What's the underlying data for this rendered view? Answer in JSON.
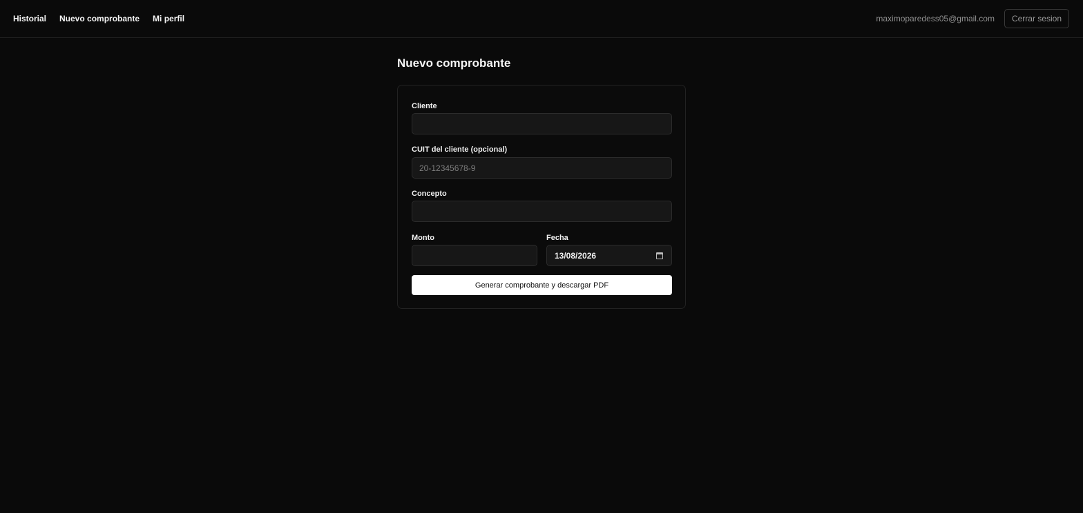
{
  "nav": {
    "items": [
      {
        "label": "Historial"
      },
      {
        "label": "Nuevo comprobante"
      },
      {
        "label": "Mi perfil"
      }
    ]
  },
  "user": {
    "email": "maximoparedess05@gmail.com",
    "logout_label": "Cerrar sesion"
  },
  "page": {
    "title": "Nuevo comprobante"
  },
  "form": {
    "cliente": {
      "label": "Cliente",
      "value": "",
      "placeholder": ""
    },
    "cuit": {
      "label": "CUIT del cliente (opcional)",
      "value": "",
      "placeholder": "20-12345678-9"
    },
    "concepto": {
      "label": "Concepto",
      "value": "",
      "placeholder": ""
    },
    "monto": {
      "label": "Monto",
      "value": "",
      "placeholder": ""
    },
    "fecha": {
      "label": "Fecha",
      "value": "13/08/2026"
    },
    "submit_label": "Generar comprobante y descargar PDF"
  }
}
